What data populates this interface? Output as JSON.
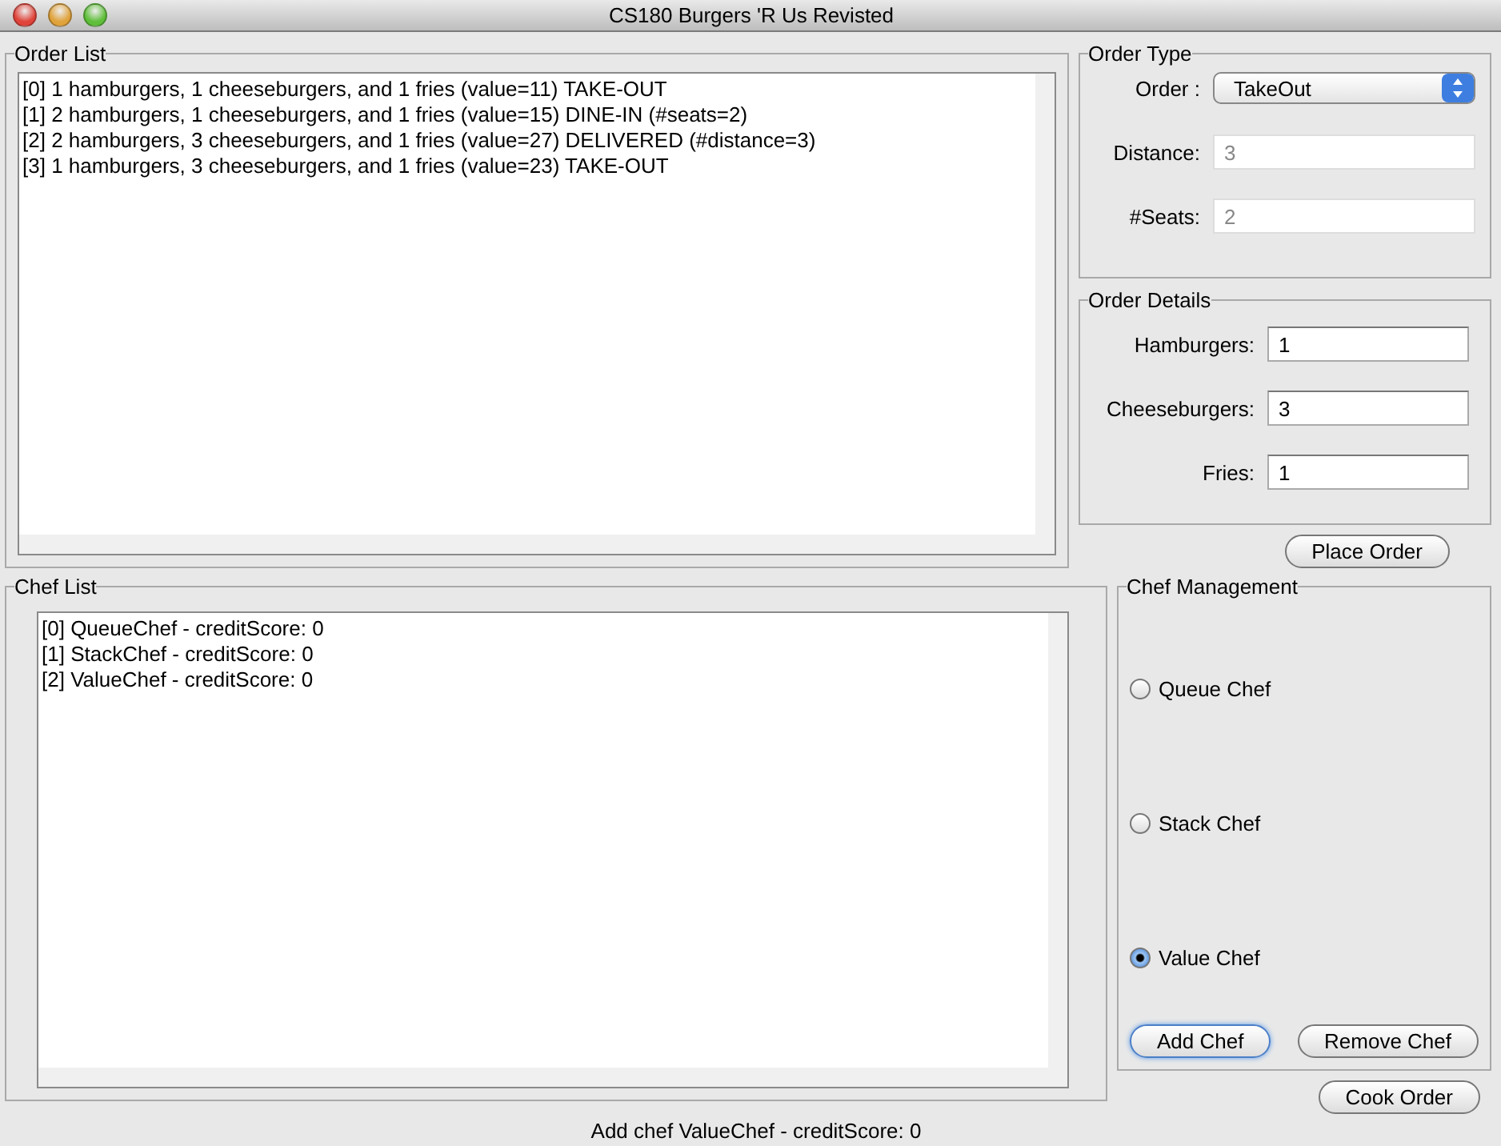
{
  "window": {
    "title": "CS180 Burgers 'R Us Revisted"
  },
  "order_list": {
    "title": "Order List",
    "items": [
      "[0] 1 hamburgers, 1 cheeseburgers, and 1 fries (value=11) TAKE-OUT",
      "[1] 2 hamburgers, 1 cheeseburgers, and 1 fries (value=15) DINE-IN (#seats=2)",
      "[2] 2 hamburgers, 3 cheeseburgers, and 1 fries (value=27) DELIVERED (#distance=3)",
      "[3] 1 hamburgers, 3 cheeseburgers, and 1 fries (value=23) TAKE-OUT"
    ]
  },
  "order_type": {
    "title": "Order Type",
    "order_label": "Order :",
    "order_value": "TakeOut",
    "fields": [
      {
        "label": "Distance:",
        "value": "3",
        "disabled": true
      },
      {
        "label": "#Seats:",
        "value": "2",
        "disabled": true
      }
    ]
  },
  "order_details": {
    "title": "Order Details",
    "fields": [
      {
        "label": "Hamburgers:",
        "value": "1",
        "disabled": false
      },
      {
        "label": "Cheeseburgers:",
        "value": "3",
        "disabled": false
      },
      {
        "label": "Fries:",
        "value": "1",
        "disabled": false
      }
    ]
  },
  "place_order_button": "Place Order",
  "chef_list": {
    "title": "Chef List",
    "items": [
      "[0] QueueChef - creditScore: 0",
      "[1] StackChef - creditScore: 0",
      "[2] ValueChef - creditScore: 0"
    ]
  },
  "chef_management": {
    "title": "Chef Management",
    "options": [
      {
        "label": "Queue Chef",
        "selected": false
      },
      {
        "label": "Stack Chef",
        "selected": false
      },
      {
        "label": "Value Chef",
        "selected": true
      }
    ],
    "buttons": [
      {
        "label": "Add Chef",
        "default": true
      },
      {
        "label": "Remove Chef",
        "default": false
      }
    ]
  },
  "cook_order_button": "Cook Order",
  "status_bar": "Add chef ValueChef - creditScore: 0"
}
